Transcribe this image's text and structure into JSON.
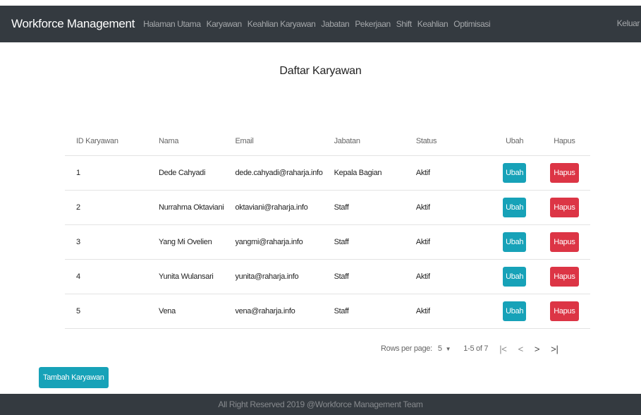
{
  "navbar": {
    "brand": "Workforce Management",
    "items": [
      "Halaman Utama",
      "Karyawan",
      "Keahlian Karyawan",
      "Jabatan",
      "Pekerjaan",
      "Shift",
      "Keahlian",
      "Optimisasi"
    ],
    "logout": "Keluar"
  },
  "page_title": "Daftar Karyawan",
  "table": {
    "headers": {
      "id": "ID Karyawan",
      "name": "Nama",
      "email": "Email",
      "position": "Jabatan",
      "status": "Status",
      "edit": "Ubah",
      "delete": "Hapus"
    },
    "rows": [
      {
        "id": "1",
        "name": "Dede Cahyadi",
        "email": "dede.cahyadi@raharja.info",
        "position": "Kepala Bagian",
        "status": "Aktif",
        "edit": "Ubah",
        "delete": "Hapus"
      },
      {
        "id": "2",
        "name": "Nurrahma Oktaviani",
        "email": "oktaviani@raharja.info",
        "position": "Staff",
        "status": "Aktif",
        "edit": "Ubah",
        "delete": "Hapus"
      },
      {
        "id": "3",
        "name": "Yang Mi Ovelien",
        "email": "yangmi@raharja.info",
        "position": "Staff",
        "status": "Aktif",
        "edit": "Ubah",
        "delete": "Hapus"
      },
      {
        "id": "4",
        "name": "Yunita Wulansari",
        "email": "yunita@raharja.info",
        "position": "Staff",
        "status": "Aktif",
        "edit": "Ubah",
        "delete": "Hapus"
      },
      {
        "id": "5",
        "name": "Vena",
        "email": "vena@raharja.info",
        "position": "Staff",
        "status": "Aktif",
        "edit": "Ubah",
        "delete": "Hapus"
      }
    ]
  },
  "pagination": {
    "rows_per_page_label": "Rows per page:",
    "rows_per_page_value": "5",
    "range_text": "1-5 of 7",
    "first_icon": "|<",
    "prev_icon": "<",
    "next_icon": ">",
    "last_icon": ">|"
  },
  "add_button": "Tambah Karyawan",
  "footer": "All Right Reserved 2019 @Workforce Management Team",
  "colors": {
    "navbar": "#343a40",
    "edit": "#17a2b8",
    "delete": "#dc3545"
  }
}
